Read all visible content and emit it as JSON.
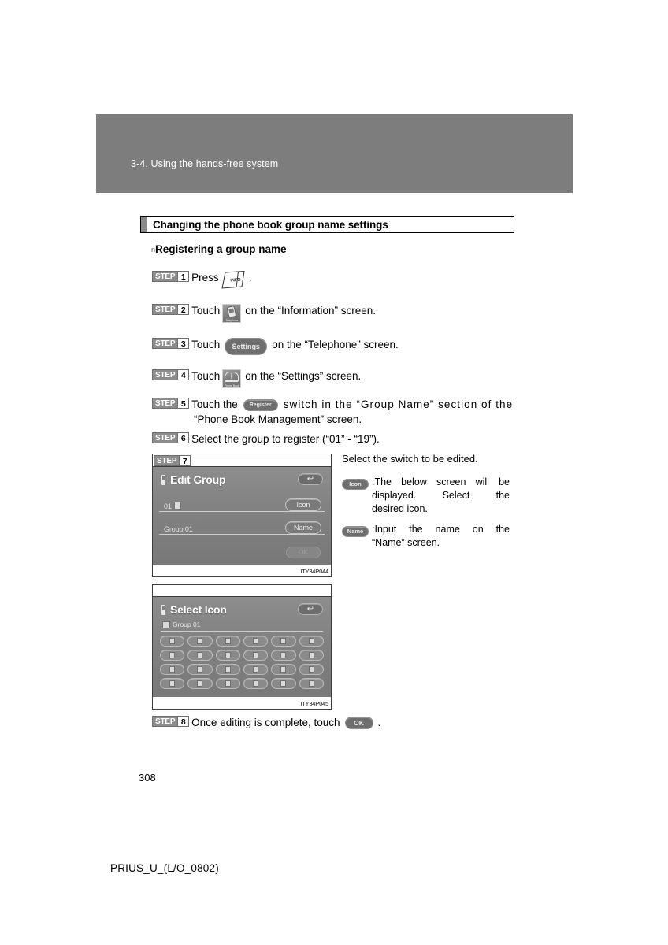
{
  "page": {
    "chapter_label": "3-4. Using the hands-free system",
    "section_title": "Changing the phone book group name settings",
    "sub_heading": "Registering a group name",
    "sub_heading_bullet": "n",
    "page_number": "308",
    "doc_footer": "PRIUS_U_(L/O_0802)"
  },
  "steps": [
    {
      "word": "STEP",
      "num": "1",
      "pre": "Press",
      "post": ".",
      "control": "INFO",
      "control_type": "info-hard-button"
    },
    {
      "word": "STEP",
      "num": "2",
      "pre": "Touch",
      "post": "on the “Information” screen.",
      "control": "Telephone",
      "control_type": "telephone-icon"
    },
    {
      "word": "STEP",
      "num": "3",
      "pre": "Touch",
      "post": "on the “Telephone” screen.",
      "control": "Settings",
      "control_type": "settings-pill"
    },
    {
      "word": "STEP",
      "num": "4",
      "pre": "Touch",
      "post": "on the “Settings” screen.",
      "control": "Phone Book",
      "control_type": "phonebook-icon"
    },
    {
      "word": "STEP",
      "num": "5",
      "pre": "Touch the",
      "post_line1": "switch in the “Group Name” section of the",
      "post_line2": "“Phone Book Management” screen.",
      "control": "Register",
      "control_type": "register-pill"
    },
    {
      "word": "STEP",
      "num": "6",
      "pre": "Select the group to register (“01” - “19”).",
      "control_type": "none"
    },
    {
      "word": "STEP",
      "num": "7",
      "control_type": "figure"
    },
    {
      "word": "STEP",
      "num": "8",
      "pre": "Once editing is complete, touch",
      "post": ".",
      "control": "OK",
      "control_type": "ok-pill"
    }
  ],
  "edit_group_screen": {
    "title": "Edit Group",
    "back_icon": "↩",
    "row1_value": "01",
    "row2_value": "Group 01",
    "icon_button": "Icon",
    "name_button": "Name",
    "ok_button": "OK",
    "figure_code": "ITY34P044"
  },
  "select_icon_screen": {
    "title": "Select Icon",
    "back_icon": "↩",
    "group_label": "Group 01",
    "figure_code": "ITY34P045",
    "grid_columns": 6,
    "grid_rows": 4,
    "icon_count": 24
  },
  "description": {
    "lead": "Select the switch to be edited.",
    "items": [
      {
        "pill": "Icon",
        "lines": [
          ":The below screen will be",
          "displayed.    Select    the",
          "desired icon."
        ]
      },
      {
        "pill": "Name",
        "lines": [
          ":Input   the   name   on   the",
          "“Name” screen."
        ]
      }
    ]
  },
  "colors": {
    "band_gray": "#7d7d7d",
    "step_badge_gray": "#8c8c8c",
    "screen_gray": "#828282",
    "pill_gray": "#6e6e6e"
  }
}
